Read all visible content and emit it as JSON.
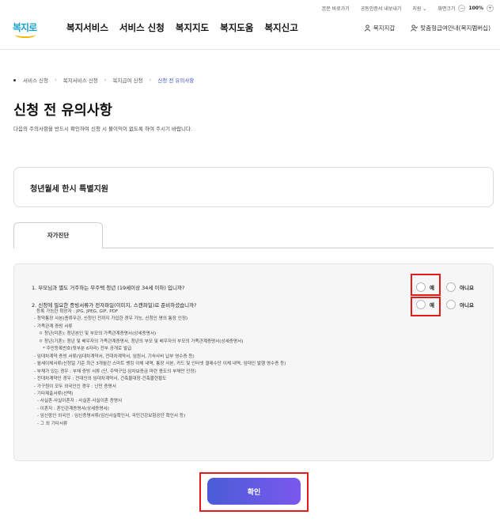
{
  "util_bar": {
    "items": [
      "본문 바로가기",
      "공동인증서 내보내기",
      "지원 ⌄",
      "화면크기"
    ],
    "zoom_level": "100%",
    "zoom_in": "+",
    "zoom_out": "−"
  },
  "logo": {
    "text": "복지로",
    "icon": "bokjiro-logo"
  },
  "nav": {
    "menu": [
      "복지서비스",
      "서비스 신청",
      "복지지도",
      "복지도움",
      "복지신고"
    ],
    "right": [
      {
        "label": "복지지갑",
        "icon": "person-icon"
      },
      {
        "label": "맞춤형급여안내(복지멤버십)",
        "icon": "person-check-icon"
      }
    ]
  },
  "breadcrumb": {
    "items": [
      "서비스 신청",
      "복지서비스 신청",
      "복지급여 신청",
      "신청 전 유의사항"
    ],
    "current_color": "#3f55c6"
  },
  "page": {
    "title": "신청 전 유의사항",
    "description": "다음의 주의사항을 반드시 확인하여 신청 시 불이익이 없도록 하여 주시기 바랍니다."
  },
  "program": {
    "name": "청년월세 한시 특별지원"
  },
  "tab": {
    "label": "자가진단"
  },
  "questions": [
    {
      "text": "1. 부모님과 별도 거주하는 무주택 청년 (19세이상 34세 이하) 입니까?",
      "yes": "예",
      "no": "아니요"
    },
    {
      "text": "2. 신청에 필요한 증빙서류가 전자파일(이미지, 스캔파일)로 준비하셨습니까?",
      "yes": "예",
      "no": "아니요"
    }
  ],
  "documents": [
    "등록 가능한 확장자 : JPG, JPEG, GIF, PDF",
    "- 청약통장 사본(종류무관, 신청인 전까지 가입한 경우 가능, 신청인 명의 통장 인정)",
    "- 가족관계 증빙 서류",
    "  ㅇ 청년(미혼): 청년본인 및 부모의 가족관계증명서(상세증명서)",
    "  ㅇ 청년(기혼): 청년 및 배우자의 가족관계증명서, 청년의 부모 및 배우자의 부모의 가족관계증명서(상세증명서)",
    "     * 주민등록번호(뒷부분 6자리) 전부 공개로 발급",
    "- 임대차계약 증빙 서류(임대차계약서, 전대차계약서, 임원서, 기숙사비 납부 영수증 등)",
    "- 월세이체서류(신청일 기준 최근 3개월간 스마트 뱅킹 이체 내역, 통장 사본, 카드 및 인터넷 결제수단 이체 내역, 임대인 발행 영수증 등)",
    "- 부채가 있는 경우 : 부채 증빙 서류 (단, 주택구입·임차보증금 마련 용도의 부채만 인정)",
    "- 전대차계약인 경우 : 전대인의 임대차계약서, 건축물대장·건축물현황도",
    "- 가구원이 모두 외국인인 경우 : 난민 증명서",
    "- 기타제출서류(선택)",
    "  - 사실혼·사실이혼자 : 사실혼·사실이혼 증명서",
    "  - 이혼자 : 혼인관계증명서(상세증명서)",
    "  - 임신중인 외국인 : 임신증명서류(임신사실확인서, 국민건강보험공단 확인서 등)",
    "  - 그 외 기타서류"
  ],
  "confirm": {
    "label": "확인"
  },
  "colors": {
    "highlight": "#e41b1b",
    "button_start": "#4a5cd6",
    "button_end": "#7b58ee"
  }
}
